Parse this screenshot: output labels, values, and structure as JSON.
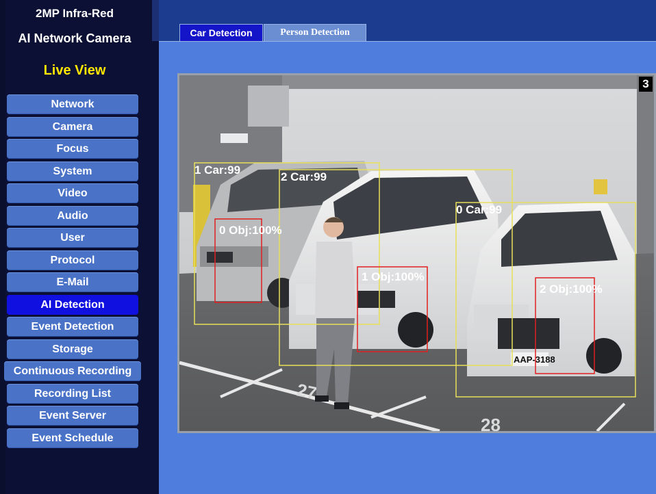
{
  "brand": {
    "line1": "2MP Infra-Red",
    "line2": "AI Network Camera"
  },
  "live_view": "Live View",
  "menu": [
    {
      "label": "Network"
    },
    {
      "label": "Camera"
    },
    {
      "label": "Focus"
    },
    {
      "label": "System"
    },
    {
      "label": "Video"
    },
    {
      "label": "Audio"
    },
    {
      "label": "User"
    },
    {
      "label": "Protocol"
    },
    {
      "label": "E-Mail"
    },
    {
      "label": "AI Detection",
      "active": true
    },
    {
      "label": "Event Detection"
    },
    {
      "label": "Storage"
    },
    {
      "label": "Continuous Recording"
    },
    {
      "label": "Recording List"
    },
    {
      "label": "Event Server"
    },
    {
      "label": "Event Schedule"
    }
  ],
  "tabs": {
    "car": "Car Detection",
    "person": "Person Detection"
  },
  "video": {
    "channel": "3",
    "detections": [
      {
        "label": "1 Car:99",
        "kind": "car"
      },
      {
        "label": "2 Car:99",
        "kind": "car"
      },
      {
        "label": "0 Car:99",
        "kind": "car"
      },
      {
        "label": "0 Obj:100%",
        "kind": "obj"
      },
      {
        "label": "1 Obj:100%",
        "kind": "obj"
      },
      {
        "label": "2 Obj:100%",
        "kind": "obj"
      }
    ],
    "plate": "AAP-3188",
    "floor_marks": [
      "27",
      "28"
    ]
  },
  "colors": {
    "car_box": "#e8e05a",
    "obj_box": "#e02020",
    "active_menu": "#1010e0",
    "menu": "#4a73c8"
  }
}
